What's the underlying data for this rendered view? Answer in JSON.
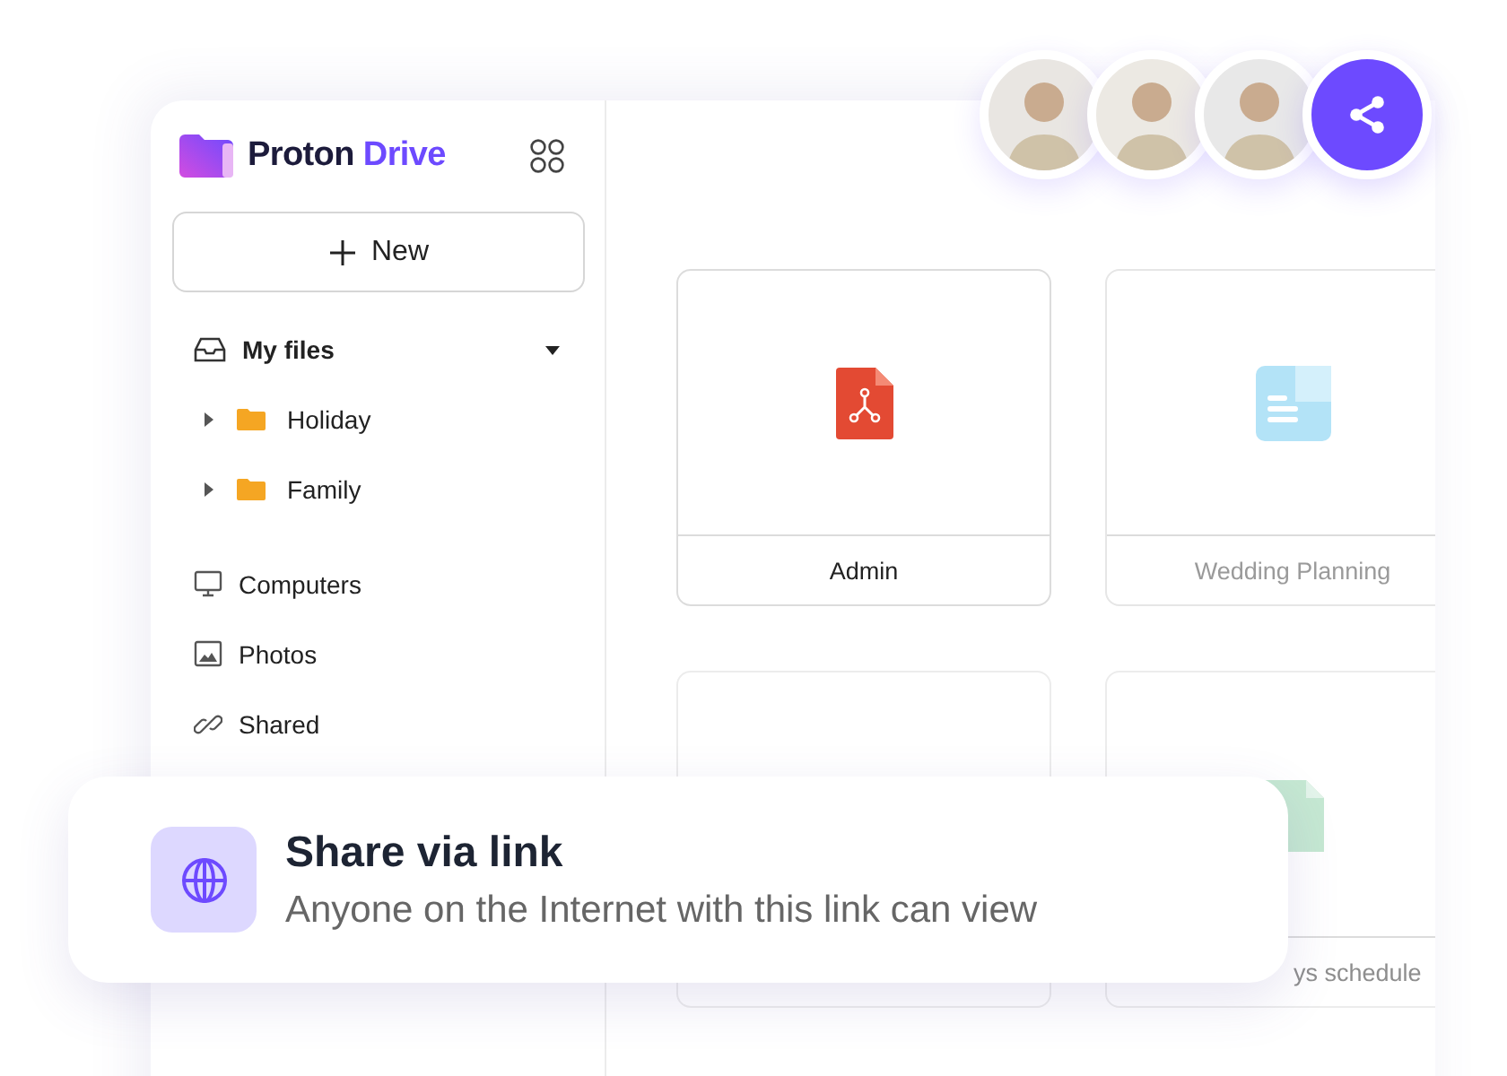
{
  "brand": {
    "word": "Proton",
    "highlight": "Drive"
  },
  "sidebar": {
    "new_button": "New",
    "my_files": {
      "label": "My files",
      "expanded": true,
      "children": [
        {
          "label": "Holiday",
          "expanded": false
        },
        {
          "label": "Family",
          "expanded": false
        }
      ]
    },
    "items": [
      {
        "label": "Computers",
        "kind": "computer"
      },
      {
        "label": "Photos",
        "kind": "photo"
      },
      {
        "label": "Shared",
        "kind": "link"
      }
    ]
  },
  "files": [
    {
      "name": "Admin",
      "kind": "pdf"
    },
    {
      "name": "Wedding Planning",
      "kind": "doc"
    },
    {
      "kind": "blank"
    },
    {
      "name": "ys schedule",
      "kind": "sheet"
    }
  ],
  "collaborators": [
    {
      "kind": "person",
      "color": "#e9e6e2"
    },
    {
      "kind": "person",
      "color": "#ece9e3"
    },
    {
      "kind": "person",
      "color": "#e8e8e8"
    }
  ],
  "share_toast": {
    "title": "Share via link",
    "text": "Anyone on the Internet with this link can view"
  }
}
